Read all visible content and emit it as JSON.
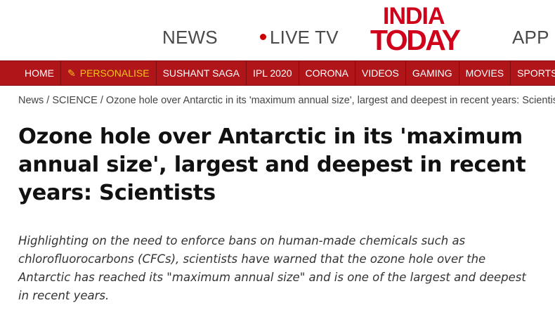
{
  "header": {
    "news_label": "NEWS",
    "live_tv_label": "LIVE TV",
    "logo_line1": "INDIA",
    "logo_line2": "TODAY",
    "app_label": "APP"
  },
  "colors": {
    "brand_red": "#b01519",
    "logo_red": "#d0021b",
    "personalise_yellow": "#f5c518"
  },
  "nav": {
    "items": [
      {
        "label": "HOME"
      },
      {
        "label": "PERSONALISE",
        "icon": "pencil-icon"
      },
      {
        "label": "SUSHANT SAGA"
      },
      {
        "label": "IPL 2020"
      },
      {
        "label": "CORONA"
      },
      {
        "label": "VIDEOS"
      },
      {
        "label": "GAMING"
      },
      {
        "label": "MOVIES"
      },
      {
        "label": "SPORTS"
      }
    ]
  },
  "breadcrumb": {
    "news": "News",
    "sep": " / ",
    "section": "SCIENCE",
    "current": "Ozone hole over Antarctic in its 'maximum annual size', largest and deepest in recent years: Scientists"
  },
  "article": {
    "title": "Ozone hole over Antarctic in its 'maximum annual size', largest and deepest in recent years: Scientists",
    "summary": "Highlighting on the need to enforce bans on human-made chemicals such as chlorofluorocarbons (CFCs), scientists have warned that the ozone hole over the Antarctic has reached its \"maximum annual size\" and is one of the largest and deepest in recent years."
  }
}
